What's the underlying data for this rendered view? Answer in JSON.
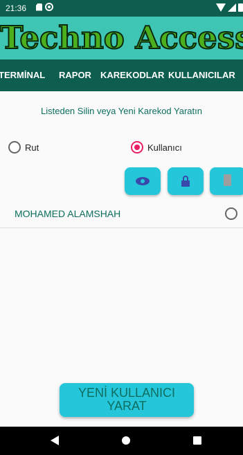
{
  "status_bar": {
    "time": "21:36"
  },
  "app": {
    "logo_text": "Techno Access"
  },
  "tabs": [
    {
      "label": "TERMİNAL"
    },
    {
      "label": "RAPOR"
    },
    {
      "label": "KAREKODLAR"
    },
    {
      "label": "KULLANICILAR"
    }
  ],
  "content": {
    "subtitle": "Listeden Silin veya Yeni Karekod Yaratın",
    "radio_options": [
      {
        "label": "Rut",
        "checked": false
      },
      {
        "label": "Kullanıcı",
        "checked": true
      }
    ],
    "action_icons": [
      "eye-icon",
      "lock-icon",
      "trash-icon"
    ],
    "list_items": [
      {
        "name": "MOHAMED ALAMSHAH",
        "selected": false
      }
    ],
    "new_button_line1": "YENİ KULLANICI",
    "new_button_line2": "YARAT"
  },
  "colors": {
    "status_bar": "#0d5e4f",
    "logo_background": "#3ec5b3",
    "tab_bar": "#0d5e4f",
    "accent": "#26c6da",
    "radio_checked": "#e91e63",
    "text_teal": "#0d6e5f"
  }
}
